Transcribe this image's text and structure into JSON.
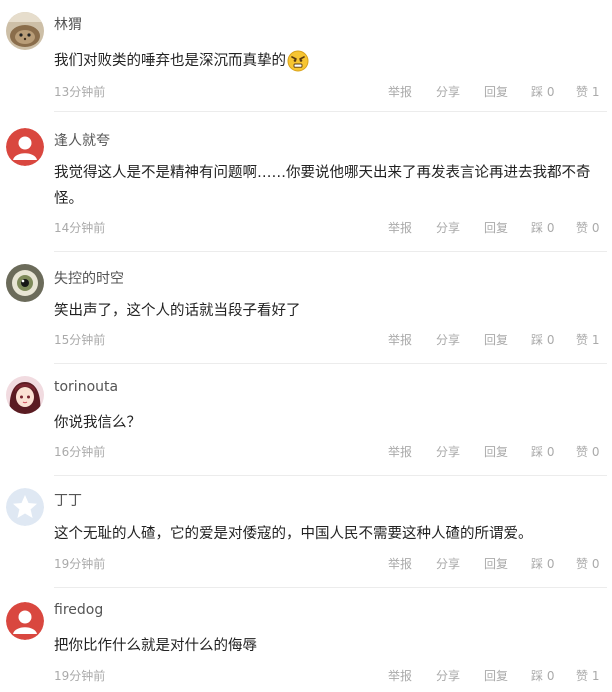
{
  "actions": {
    "report": "举报",
    "share": "分享",
    "reply": "回复",
    "downvote_label": "踩",
    "upvote_label": "赞"
  },
  "comments": [
    {
      "name": "林猬",
      "text": "我们对败类的唾弃也是深沉而真挚的",
      "time": "13分钟前",
      "downvotes": "0",
      "upvotes": "1",
      "emoji": "angry-face-icon"
    },
    {
      "name": "逢人就夸",
      "text": "我觉得这人是不是精神有问题啊……你要说他哪天出来了再发表言论再进去我都不奇怪。",
      "time": "14分钟前",
      "downvotes": "0",
      "upvotes": "0"
    },
    {
      "name": "失控的时空",
      "text": "笑出声了，这个人的话就当段子看好了",
      "time": "15分钟前",
      "downvotes": "0",
      "upvotes": "1"
    },
    {
      "name": "torinouta",
      "text": "你说我信么？",
      "time": "16分钟前",
      "downvotes": "0",
      "upvotes": "0"
    },
    {
      "name": "丁丁",
      "text": "这个无耻的人碴，它的爱是对倭寇的，中国人民不需要这种人碴的所谓爱。",
      "time": "19分钟前",
      "downvotes": "0",
      "upvotes": "0"
    },
    {
      "name": "firedog",
      "text": "把你比作什么就是对什么的侮辱",
      "time": "19分钟前",
      "downvotes": "0",
      "upvotes": "1"
    }
  ],
  "colors": {
    "default_avatar": "#d9473f",
    "star_avatar": "#dfe8f3"
  }
}
